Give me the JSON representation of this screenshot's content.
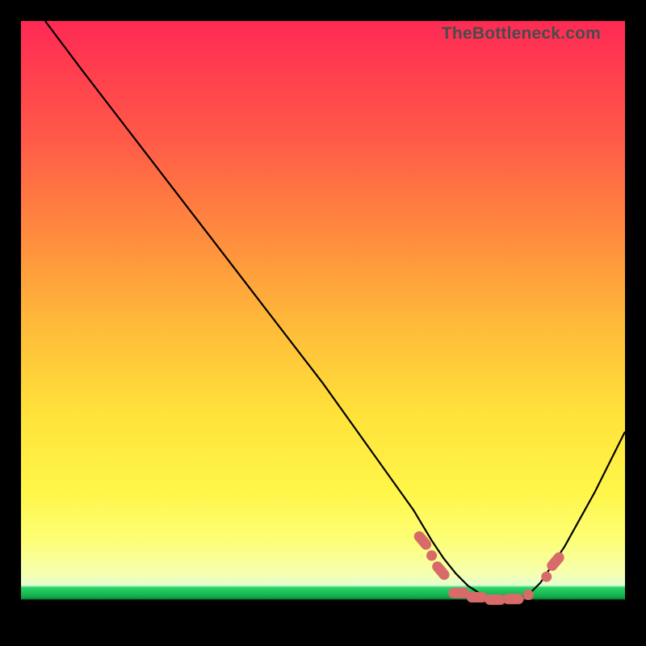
{
  "watermark": "TheBottleneck.com",
  "chart_data": {
    "type": "line",
    "title": "",
    "xlabel": "",
    "ylabel": "",
    "xlim": [
      0,
      100
    ],
    "ylim": [
      0,
      100
    ],
    "grid": false,
    "series": [
      {
        "name": "bottleneck-curve",
        "x": [
          4,
          10,
          20,
          30,
          40,
          50,
          60,
          65,
          68,
          70,
          72,
          74,
          76,
          78,
          80,
          82,
          84,
          86,
          90,
          95,
          100
        ],
        "y": [
          100,
          92,
          79,
          66,
          53,
          40,
          26,
          19,
          14,
          11,
          8.5,
          6.5,
          5.2,
          4.5,
          4.2,
          4.3,
          5.0,
          7.0,
          13,
          22,
          32
        ]
      }
    ],
    "scatter": {
      "name": "highlight-points",
      "points": [
        {
          "x": 66.5,
          "y": 14.0,
          "shape": "pill-diag"
        },
        {
          "x": 68.0,
          "y": 11.5,
          "shape": "dot"
        },
        {
          "x": 69.5,
          "y": 9.0,
          "shape": "pill-diag"
        },
        {
          "x": 72.5,
          "y": 5.3,
          "shape": "pill-h"
        },
        {
          "x": 75.5,
          "y": 4.6,
          "shape": "pill-h"
        },
        {
          "x": 78.5,
          "y": 4.2,
          "shape": "pill-h"
        },
        {
          "x": 81.5,
          "y": 4.3,
          "shape": "pill-h"
        },
        {
          "x": 84.0,
          "y": 5.0,
          "shape": "dot"
        },
        {
          "x": 87.0,
          "y": 8.0,
          "shape": "dot"
        },
        {
          "x": 88.5,
          "y": 10.5,
          "shape": "pill-diag-up"
        }
      ]
    },
    "gradient_stops": [
      {
        "pos": 0.0,
        "color": "#ff2a55"
      },
      {
        "pos": 0.5,
        "color": "#ffb93a"
      },
      {
        "pos": 0.86,
        "color": "#fdff76"
      },
      {
        "pos": 0.94,
        "color": "#2bd36a"
      },
      {
        "pos": 0.96,
        "color": "#000000"
      }
    ]
  }
}
